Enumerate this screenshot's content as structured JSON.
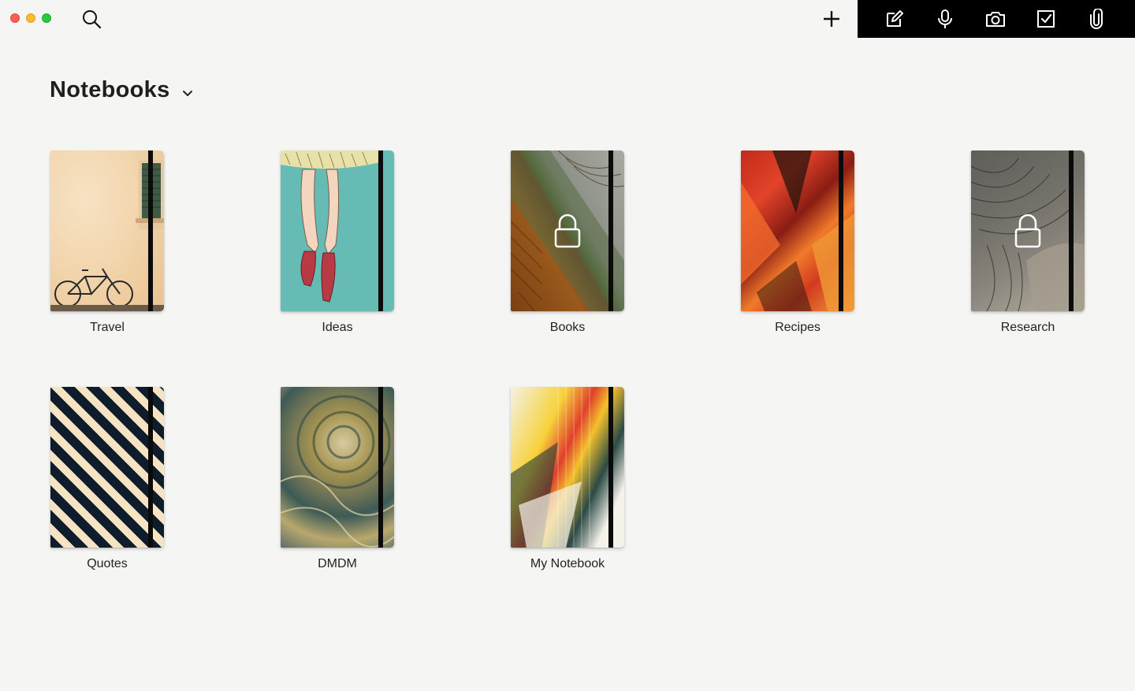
{
  "window": {
    "traffic_lights": [
      "close",
      "minimize",
      "maximize"
    ]
  },
  "header": {
    "search_icon": "search-icon",
    "add_icon": "plus-icon",
    "title": "Notebooks",
    "title_dropdown_icon": "chevron-down-icon"
  },
  "toolbar": {
    "items": [
      {
        "icon": "compose-icon"
      },
      {
        "icon": "microphone-icon"
      },
      {
        "icon": "camera-icon"
      },
      {
        "icon": "checkbox-icon"
      },
      {
        "icon": "paperclip-icon"
      }
    ],
    "background": "#000000"
  },
  "notebooks": [
    {
      "label": "Travel",
      "locked": false
    },
    {
      "label": "Ideas",
      "locked": false
    },
    {
      "label": "Books",
      "locked": true
    },
    {
      "label": "Recipes",
      "locked": false
    },
    {
      "label": "Research",
      "locked": true
    },
    {
      "label": "Quotes",
      "locked": false
    },
    {
      "label": "DMDM",
      "locked": false
    },
    {
      "label": "My Notebook",
      "locked": false
    }
  ],
  "colors": {
    "background": "#f5f5f4",
    "text": "#1e1e1e"
  }
}
